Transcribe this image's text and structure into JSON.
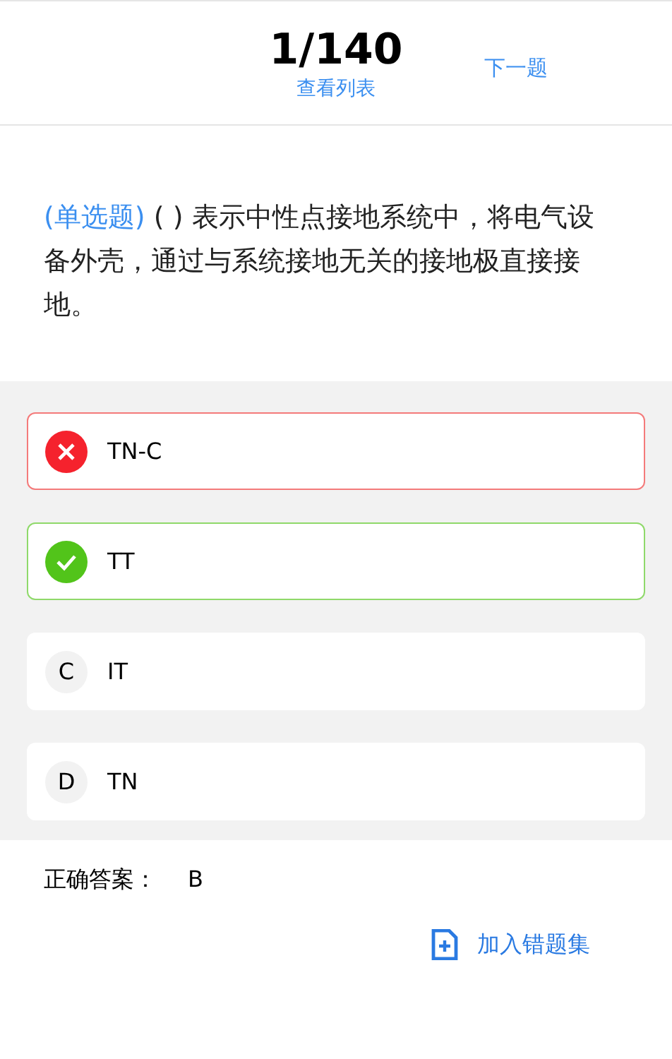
{
  "header": {
    "progress": "1/140",
    "list_link": "查看列表",
    "next_link": "下一题"
  },
  "question": {
    "type_label": "(单选题)",
    "text": "(    ) 表示中性点接地系统中，将电气设备外壳，通过与系统接地无关的接地极直接接地。"
  },
  "options": [
    {
      "kind": "wrong",
      "text": "TN-C"
    },
    {
      "kind": "correct",
      "text": "TT"
    },
    {
      "kind": "plain",
      "letter": "C",
      "text": "IT"
    },
    {
      "kind": "plain",
      "letter": "D",
      "text": "TN"
    }
  ],
  "answer": {
    "label": "正确答案：",
    "value": "B"
  },
  "add_button": {
    "label": "加入错题集"
  }
}
